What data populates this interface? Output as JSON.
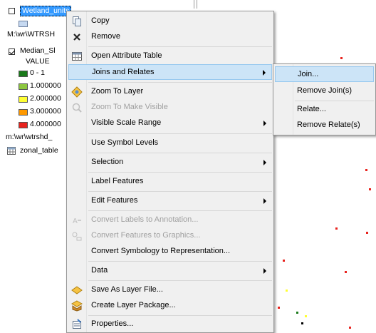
{
  "toc": {
    "layer_name": "Wetland_units",
    "path1": "M:\\wr\\WTRSH",
    "median_layer": "Median_Sl",
    "value_header": "VALUE",
    "legend": [
      {
        "label": "0 - 1",
        "color": "#1a7a1a"
      },
      {
        "label": "1.000000",
        "color": "#8cc63f"
      },
      {
        "label": "2.000000",
        "color": "#ffff33"
      },
      {
        "label": "3.000000",
        "color": "#ff9900"
      },
      {
        "label": "4.000000",
        "color": "#e8231e"
      }
    ],
    "path2": "m:\\wr\\wtrshd_",
    "zonal_table": "zonal_table"
  },
  "context_menu": {
    "items": [
      {
        "label": "Copy",
        "icon": "copy-icon",
        "enabled": true
      },
      {
        "label": "Remove",
        "icon": "remove-x-icon",
        "enabled": true
      },
      {
        "label": "Open Attribute Table",
        "icon": "table-icon",
        "enabled": true
      },
      {
        "label": "Joins and Relates",
        "icon": "",
        "enabled": true,
        "submenu": true,
        "highlighted": true
      },
      {
        "label": "Zoom To Layer",
        "icon": "zoom-layer-icon",
        "enabled": true
      },
      {
        "label": "Zoom To Make Visible",
        "icon": "zoom-visible-icon",
        "enabled": false
      },
      {
        "label": "Visible Scale Range",
        "icon": "",
        "enabled": true,
        "submenu": true
      },
      {
        "label": "Use Symbol Levels",
        "icon": "",
        "enabled": true
      },
      {
        "label": "Selection",
        "icon": "",
        "enabled": true,
        "submenu": true
      },
      {
        "label": "Label Features",
        "icon": "",
        "enabled": true
      },
      {
        "label": "Edit Features",
        "icon": "",
        "enabled": true,
        "submenu": true
      },
      {
        "label": "Convert Labels to Annotation...",
        "icon": "convert-labels-icon",
        "enabled": false
      },
      {
        "label": "Convert Features to Graphics...",
        "icon": "convert-features-icon",
        "enabled": false
      },
      {
        "label": "Convert Symbology to Representation...",
        "icon": "",
        "enabled": true
      },
      {
        "label": "Data",
        "icon": "",
        "enabled": true,
        "submenu": true
      },
      {
        "label": "Save As Layer File...",
        "icon": "layer-file-icon",
        "enabled": true
      },
      {
        "label": "Create Layer Package...",
        "icon": "layer-package-icon",
        "enabled": true
      },
      {
        "label": "Properties...",
        "icon": "properties-icon",
        "enabled": true
      }
    ]
  },
  "joins_submenu": {
    "items": [
      {
        "label": "Join...",
        "highlighted": true
      },
      {
        "label": "Remove Join(s)"
      },
      {
        "label": "Relate..."
      },
      {
        "label": "Remove Relate(s)"
      }
    ]
  },
  "colors": {
    "menu_bg": "#f0f0f0",
    "highlight": "#cce4f7",
    "highlight_border": "#99c9ef",
    "selection_blue": "#3399ff"
  }
}
